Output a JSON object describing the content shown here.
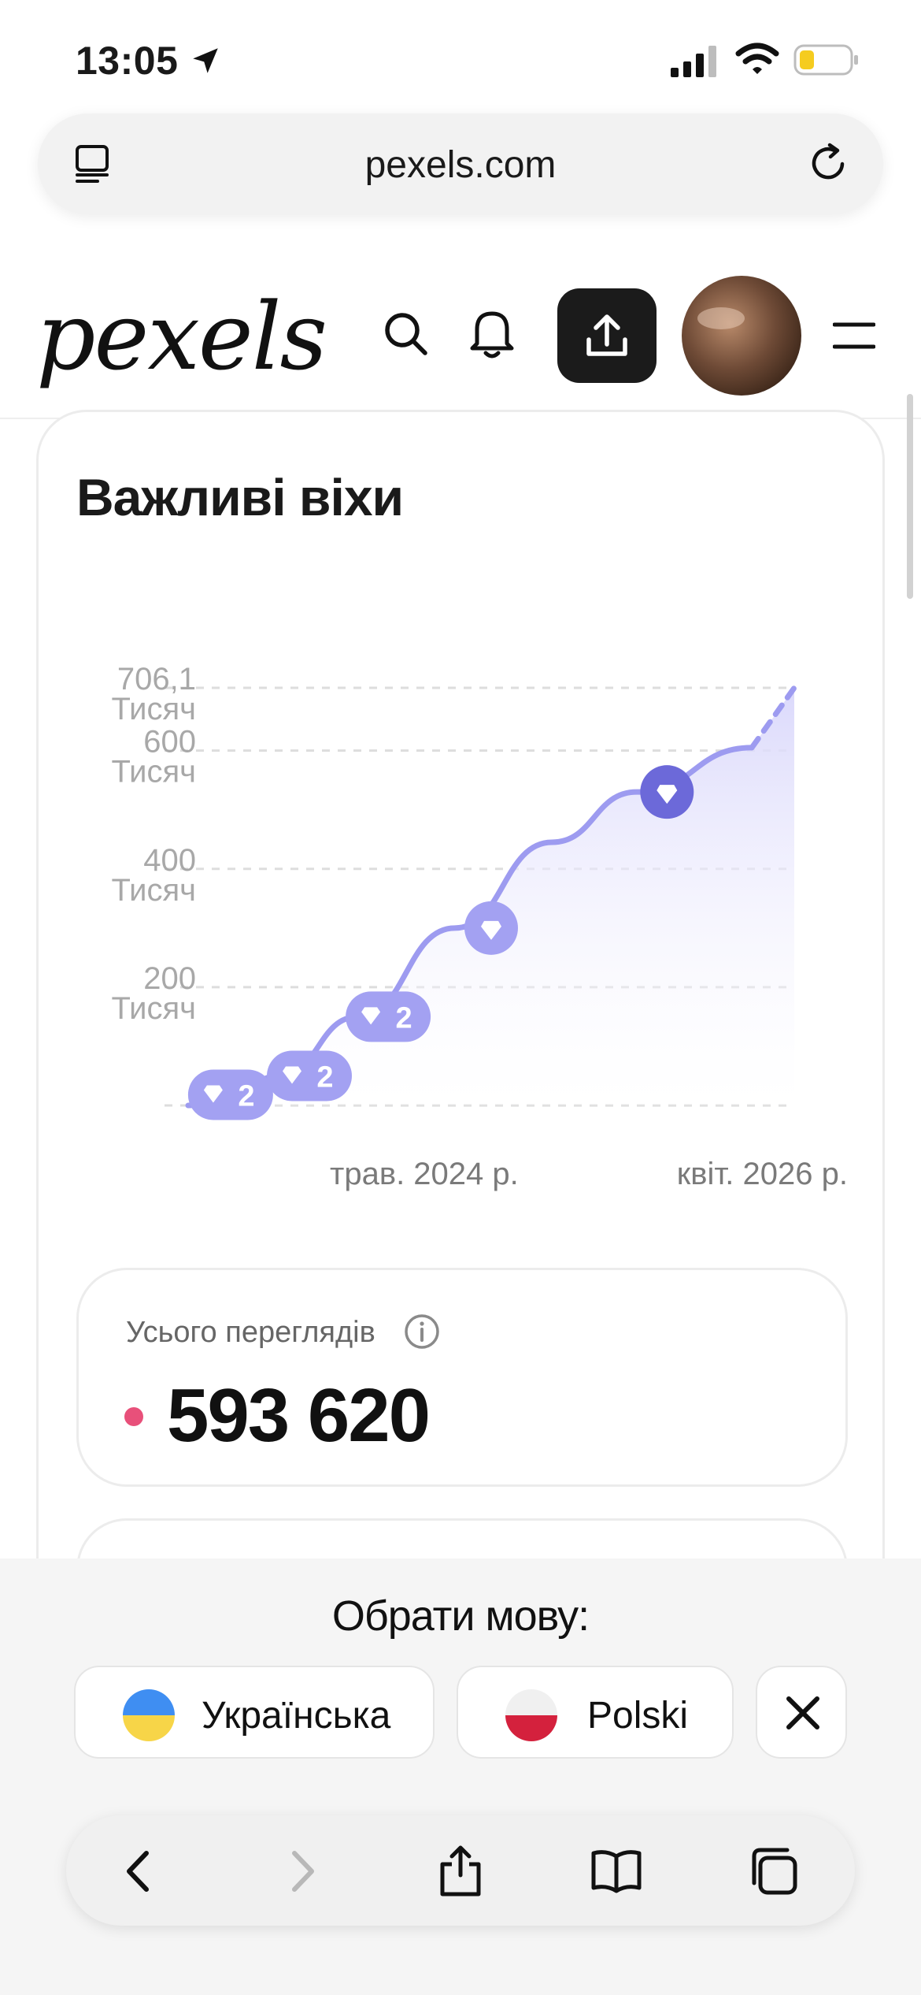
{
  "status_bar": {
    "time": "13:05"
  },
  "browser": {
    "url": "pexels.com"
  },
  "header": {
    "logo": "pexels",
    "icons": [
      "search-icon",
      "bell-icon",
      "upload-icon",
      "avatar",
      "menu-icon"
    ]
  },
  "card": {
    "title": "Важливі віхи",
    "chart_data": {
      "type": "area",
      "x_labels": [
        "трав. 2024 р.",
        "квіт. 2026 р."
      ],
      "y_ticks": [
        {
          "value": 200000,
          "label_line1": "200",
          "label_line2": "Тисяч"
        },
        {
          "value": 400000,
          "label_line1": "400",
          "label_line2": "Тисяч"
        },
        {
          "value": 600000,
          "label_line1": "600",
          "label_line2": "Тисяч"
        },
        {
          "value": 706100,
          "label_line1": "706,1",
          "label_line2": "Тисяч"
        }
      ],
      "ylim": [
        0,
        706100
      ],
      "series": [
        {
          "points": [
            {
              "x": 0.0,
              "y": 0
            },
            {
              "x": 0.07,
              "y": 18000
            },
            {
              "x": 0.15,
              "y": 50000
            },
            {
              "x": 0.28,
              "y": 150000
            },
            {
              "x": 0.44,
              "y": 300000
            },
            {
              "x": 0.6,
              "y": 445000
            },
            {
              "x": 0.74,
              "y": 530000
            },
            {
              "x": 0.93,
              "y": 605000
            },
            {
              "x": 1.0,
              "y": 706100
            }
          ],
          "projected_from_x": 0.93
        }
      ],
      "milestones": [
        {
          "x": 0.07,
          "y": 18000,
          "count": "2"
        },
        {
          "x": 0.2,
          "y": 50000,
          "count": "2"
        },
        {
          "x": 0.33,
          "y": 150000,
          "count": "2"
        },
        {
          "x": 0.5,
          "y": 300000,
          "count": ""
        },
        {
          "x": 0.79,
          "y": 530000,
          "count": "",
          "highlight": true
        }
      ],
      "colors": {
        "line": "#9d9bf0",
        "fill_top": "#dcdafb",
        "milestone": "#a3a1f2",
        "milestone_highlight": "#6c69d9"
      }
    },
    "stats": {
      "label": "Усього переглядів",
      "value": "593 620",
      "dot_color": "#e8507a"
    }
  },
  "language_banner": {
    "title": "Обрати мову:",
    "options": [
      {
        "label": "Українська",
        "flag": "ukraine-flag"
      },
      {
        "label": "Polski",
        "flag": "poland-flag"
      }
    ]
  },
  "toolbar": {
    "icons": [
      "back-icon",
      "forward-icon",
      "share-icon",
      "bookmarks-icon",
      "tabs-icon"
    ]
  }
}
